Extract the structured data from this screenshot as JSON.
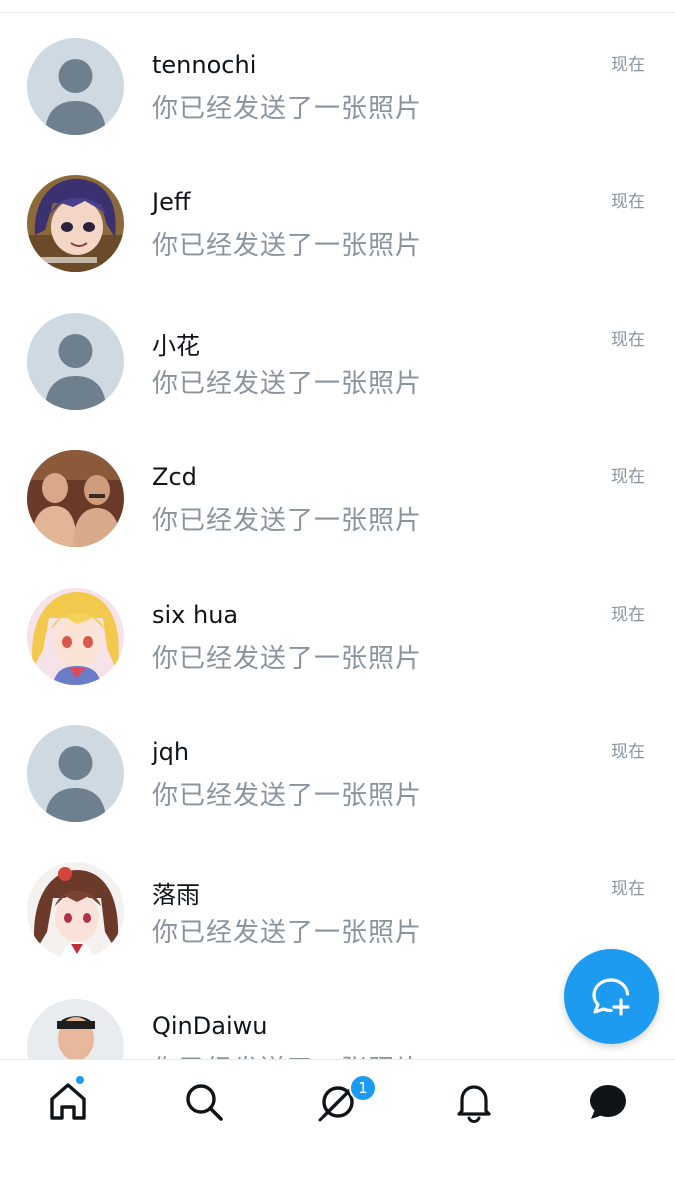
{
  "conversations": [
    {
      "name": "tennochi",
      "preview": "你已经发送了一张照片",
      "time": "现在",
      "avatar": "default-avatar"
    },
    {
      "name": "Jeff",
      "preview": "你已经发送了一张照片",
      "time": "现在",
      "avatar": "anime-girl-purple-hair"
    },
    {
      "name": "小花",
      "preview": "你已经发送了一张照片",
      "time": "现在",
      "avatar": "default-avatar"
    },
    {
      "name": "Zcd",
      "preview": "你已经发送了一张照片",
      "time": "现在",
      "avatar": "photo-two-men"
    },
    {
      "name": "six hua",
      "preview": "你已经发送了一张照片",
      "time": "现在",
      "avatar": "anime-girl-blonde"
    },
    {
      "name": "jqh",
      "preview": "你已经发送了一张照片",
      "time": "现在",
      "avatar": "default-avatar"
    },
    {
      "name": "落雨",
      "preview": "你已经发送了一张照片",
      "time": "现在",
      "avatar": "anime-girl-brown-hair"
    },
    {
      "name": "QinDaiwu",
      "preview": "你已经发送了一张照片",
      "time": "",
      "avatar": "photo-young-man"
    }
  ],
  "tabbar": {
    "messages_badge": "1",
    "icons": [
      "home-icon",
      "search-icon",
      "spaces-icon",
      "bell-icon",
      "messages-icon"
    ]
  },
  "fab": {
    "icon": "new-message-icon"
  },
  "colors": {
    "accent": "#1d9bf0",
    "text": "#0f1419",
    "muted": "#8a949e",
    "avatar_default_bg": "#cfd9e1",
    "avatar_default_fg": "#6e7f8e"
  }
}
